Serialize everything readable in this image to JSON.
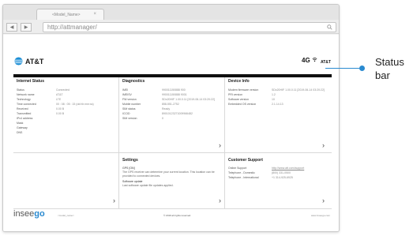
{
  "browser": {
    "tab_title": "<Model_Name>",
    "tab_close": "×",
    "back": "◀",
    "forward": "▶",
    "url": "http://attmanager/"
  },
  "header": {
    "logo": "AT&T",
    "network_type": "4G",
    "carrier": "AT&T"
  },
  "panels": {
    "internet_status": {
      "title": "Internet Status",
      "rows": [
        {
          "label": "Status",
          "value": "Connected"
        },
        {
          "label": "Network name",
          "value": "AT&T"
        },
        {
          "label": "Technology",
          "value": "LTE"
        },
        {
          "label": "Time connected",
          "value": "00 : 08 : 05 : 15 (dd:hh:mm:ss)"
        },
        {
          "label": "Received",
          "value": "0.00 B"
        },
        {
          "label": "Transmitted",
          "value": "0.00 B"
        },
        {
          "label": "IPv4 address",
          "value": ""
        },
        {
          "label": "Mask",
          "value": ""
        },
        {
          "label": "Gateway",
          "value": ""
        },
        {
          "label": "DNS",
          "value": ""
        }
      ]
    },
    "diagnostics": {
      "title": "Diagnostics",
      "rows": [
        {
          "label": "IMEI",
          "value": "990011150888 900"
        },
        {
          "label": "IMEISV",
          "value": "990011150888 9001"
        },
        {
          "label": "FW version",
          "value": "SDx20HIF 1.00.0.11 [2019-06-14 03:20:22]"
        },
        {
          "label": "Mobile number",
          "value": "858-551-2752"
        },
        {
          "label": "SIM status",
          "value": "Ready"
        },
        {
          "label": "ICCID",
          "value": "89010123271009966482"
        },
        {
          "label": "SIM version",
          "value": "0"
        }
      ]
    },
    "device_info": {
      "title": "Device Info",
      "rows": [
        {
          "label": "Modem firmware version",
          "value": "SDx20HIF 1.00.0.11 [2019-06-14 03:20:22]"
        },
        {
          "label": "PRI version",
          "value": "1.2"
        },
        {
          "label": "Software version",
          "value": "10"
        },
        {
          "label": "Embedded OS version",
          "value": "2.1.14.13"
        }
      ]
    },
    "settings": {
      "title": "Settings",
      "gps_heading": "GPS [ON]",
      "gps_text": "The GPS receiver can determine your current location. This location can be provided to connected devices.",
      "update_heading": "Software update",
      "update_text": "Last software update file updates applied."
    },
    "customer_support": {
      "title": "Customer Support",
      "rows": [
        {
          "label": "Online Support",
          "value": "http://www.att.com/support"
        },
        {
          "label": "Telephone - Domestic",
          "value": "(800) 331-0500"
        },
        {
          "label": "Telephone - International",
          "value": "+1 314-925-6925"
        }
      ]
    },
    "chevron": "›"
  },
  "footer": {
    "brand_left": "insee",
    "brand_right": "go",
    "model": "<model_name>",
    "copyright": "© 2019 all rights reserved.",
    "url": "www.inseego.com"
  },
  "callout": {
    "label": "Status bar"
  },
  "colors": {
    "accent": "#2a8ad0",
    "header_bar": "#0f0f0f"
  }
}
